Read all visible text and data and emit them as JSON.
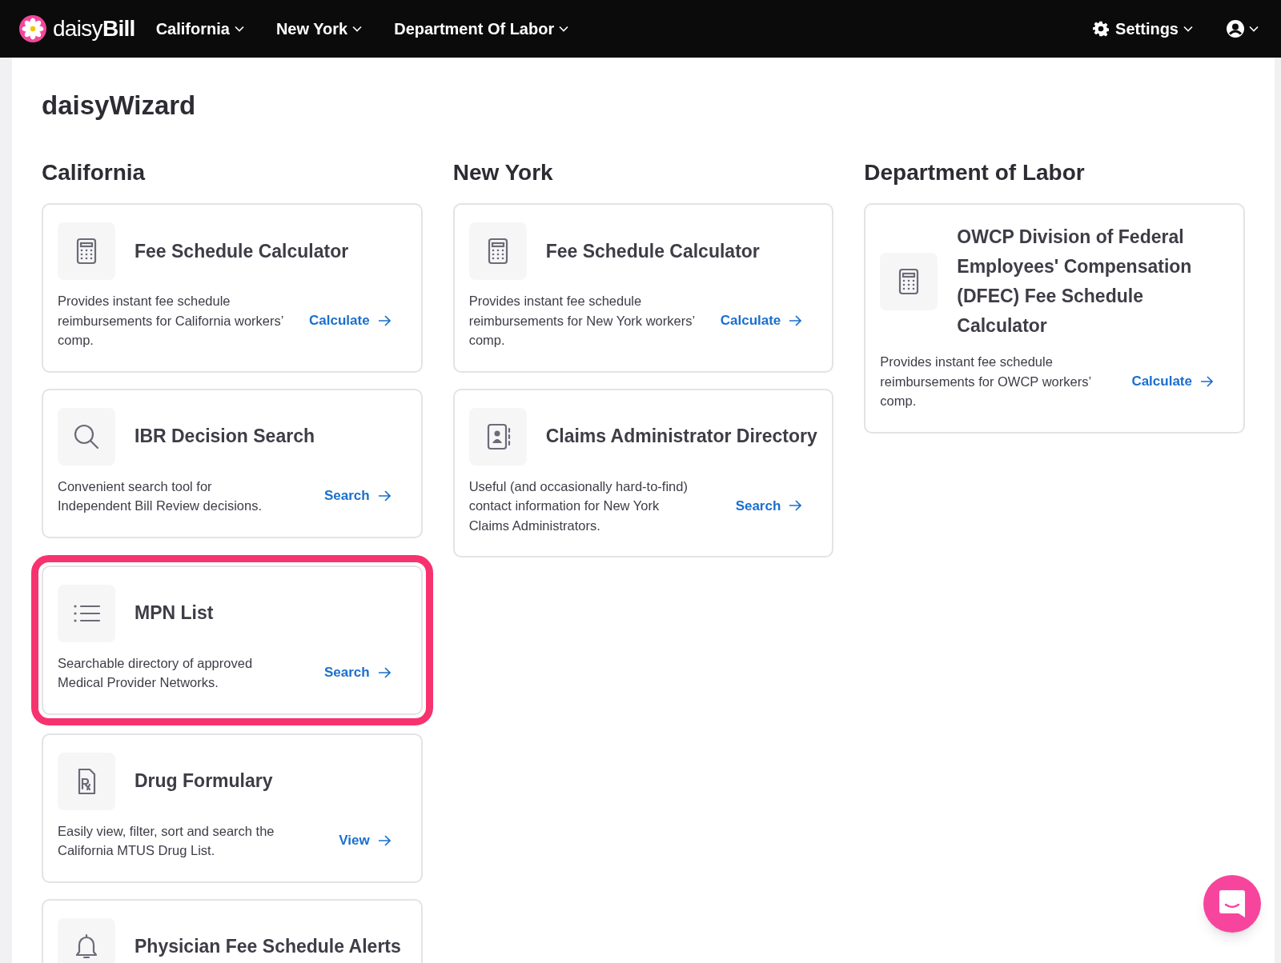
{
  "nav": {
    "brand": {
      "light": "daisy",
      "bold": "Bill"
    },
    "menus": [
      {
        "label": "California"
      },
      {
        "label": "New York"
      },
      {
        "label": "Department Of Labor"
      }
    ],
    "settings": {
      "label": "Settings"
    }
  },
  "page_title": "daisyWizard",
  "columns": [
    {
      "heading": "California",
      "cards": [
        {
          "kind": "calculator",
          "title": "Fee Schedule Calculator",
          "description": "Provides instant fee schedule reimbursements for California workers’ comp.",
          "action": "Calculate",
          "highlighted": false
        },
        {
          "kind": "search",
          "title": "IBR Decision Search",
          "description": "Convenient search tool for Independent Bill Review decisions.",
          "action": "Search",
          "highlighted": false
        },
        {
          "kind": "list",
          "title": "MPN List",
          "description": "Searchable directory of approved Medical Provider Networks.",
          "action": "Search",
          "highlighted": true
        },
        {
          "kind": "rx",
          "title": "Drug Formulary",
          "description": "Easily view, filter, sort and search the California MTUS Drug List.",
          "action": "View",
          "highlighted": false
        },
        {
          "kind": "bell",
          "title": "Physician Fee Schedule Alerts",
          "highlighted": false
        }
      ]
    },
    {
      "heading": "New York",
      "cards": [
        {
          "kind": "calculator",
          "title": "Fee Schedule Calculator",
          "description": "Provides instant fee schedule reimbursements for New York workers’ comp.",
          "action": "Calculate",
          "highlighted": false
        },
        {
          "kind": "contact",
          "title": "Claims Administrator Directory",
          "description": "Useful (and occasionally hard-to-find) contact information for New York Claims Administrators.",
          "action": "Search",
          "highlighted": false
        }
      ]
    },
    {
      "heading": "Department of Labor",
      "cards": [
        {
          "kind": "calculator",
          "title": "OWCP Division of Federal Employees' Compensation (DFEC) Fee Schedule Calculator",
          "description": "Provides instant fee schedule reimbursements for OWCP workers’ comp.",
          "action": "Calculate",
          "highlighted": false
        }
      ]
    }
  ]
}
